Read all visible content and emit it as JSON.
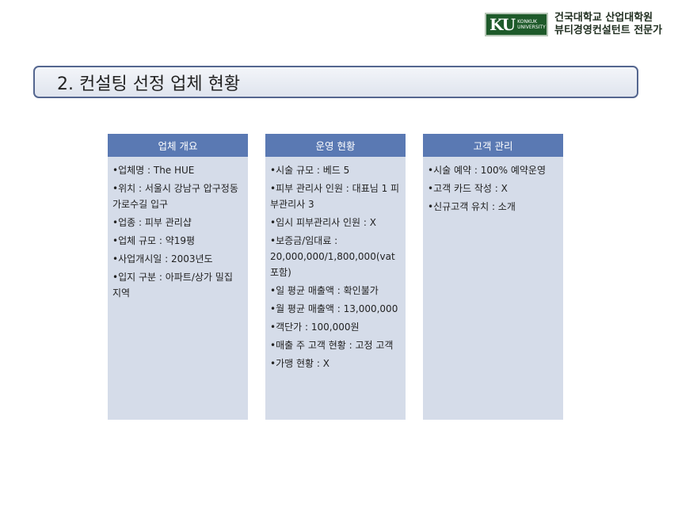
{
  "header": {
    "logo_mark": "KU",
    "logo_sub": [
      "KONKUK",
      "UNIVERSITY"
    ],
    "institution": [
      "건국대학교 산업대학원",
      "뷰티경영컨설턴트 전문가"
    ]
  },
  "title": "2. 컨설팅 선정 업체 현황",
  "colors": {
    "panel_header": "#5a79b3",
    "panel_body": "#d5dce9",
    "title_border": "#54668f",
    "logo_green": "#1e5a2a"
  },
  "panels": [
    {
      "header": "업체 개요",
      "items": [
        "•업체명 : The HUE",
        "•위치 :  서울시 강남구 압구정동 가로수길 입구",
        "•업종 : 피부 관리샵",
        "•업체 규모 : 약19평",
        "•사업개시일 : 2003년도",
        "•입지 구분 : 아파트/상가 밀집 지역"
      ]
    },
    {
      "header": "운영 현황",
      "items": [
        "•시술 규모 : 베드 5",
        "•피부 관리사 인원 : 대표님 1 피부관리사 3",
        "•임시 피부관리사 인원 : X",
        "•보증금/임대료 : 20,000,000/1,800,000(vat 포함)",
        "•일 평균 매출액 : 확인불가",
        "•월 평균 매출액 : 13,000,000",
        "•객단가 : 100,000원",
        "•매출 주 고객 현황 : 고정 고객",
        "•가맹 현황 : X"
      ]
    },
    {
      "header": "고객 관리",
      "items": [
        "•시술 예약 : 100%  예약운영",
        "•고객 카드 작성 : X",
        "•신규고객 유치 : 소개"
      ]
    }
  ]
}
